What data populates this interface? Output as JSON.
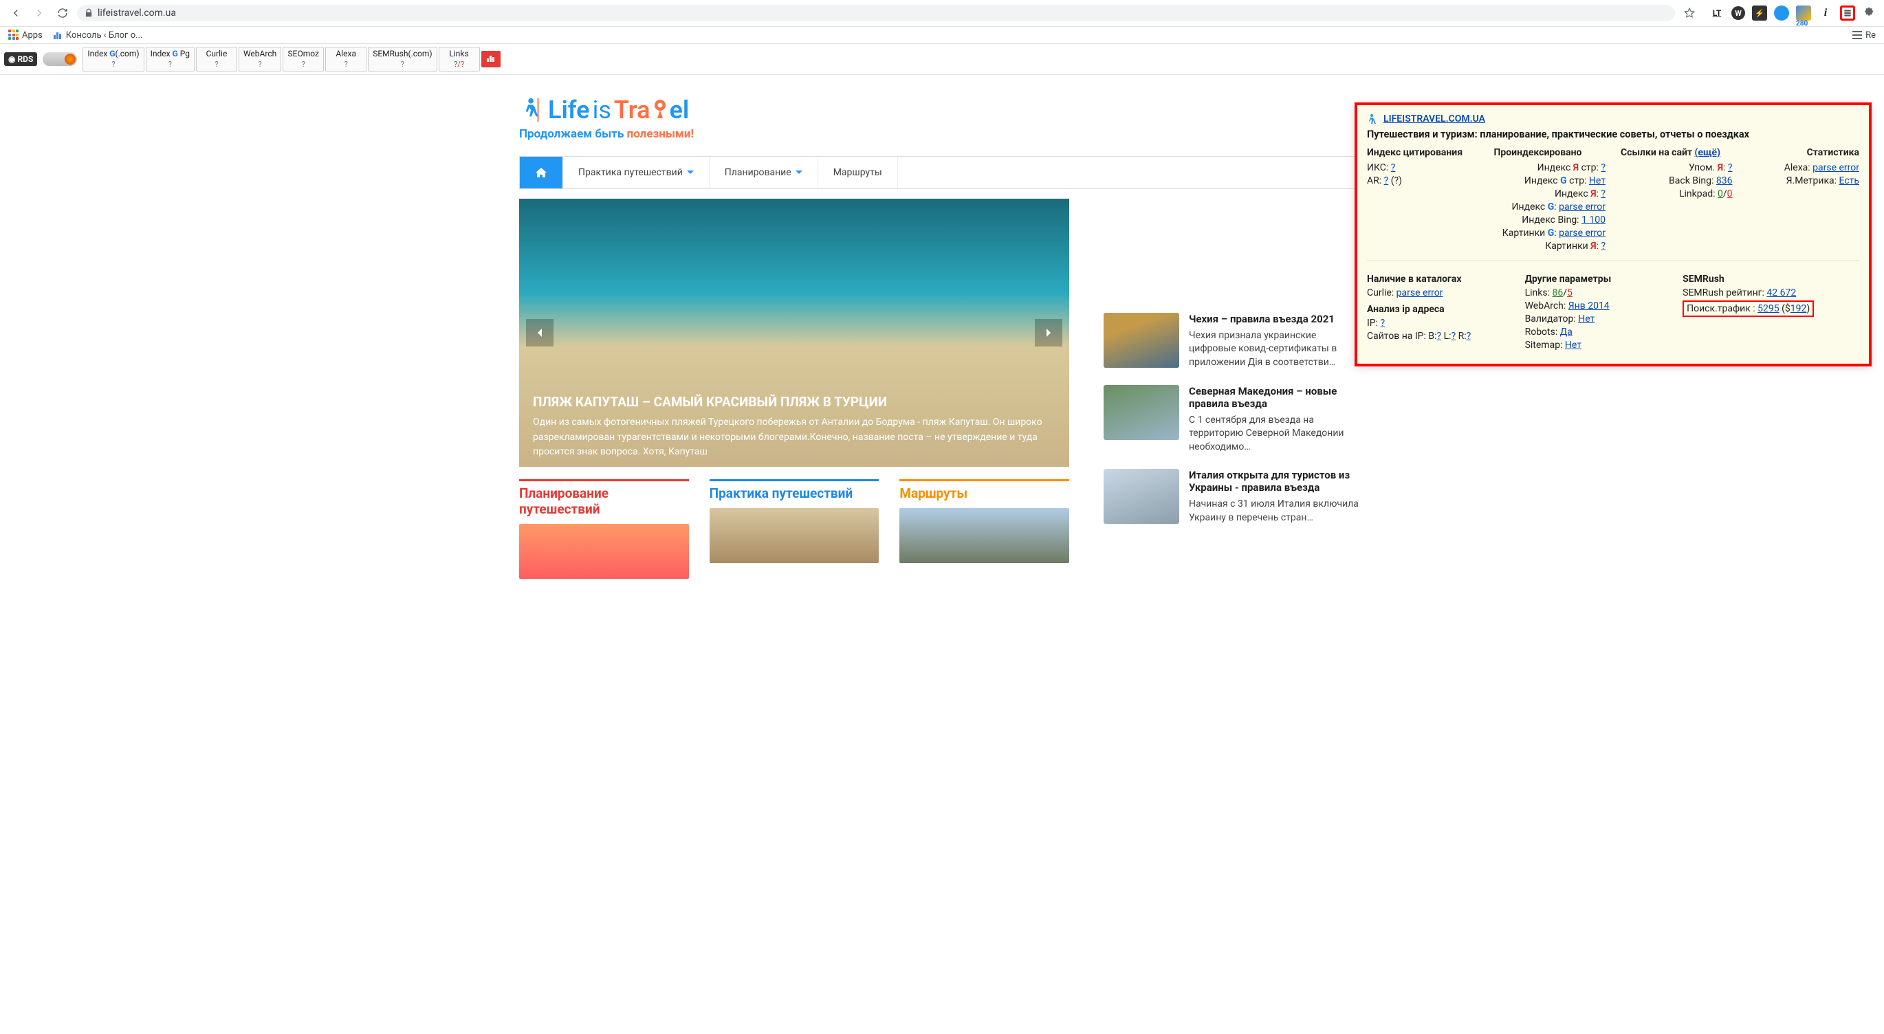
{
  "browser": {
    "url_host": "lifeistravel.com.ua",
    "bookmarks": {
      "apps_label": "Apps",
      "konsol_label": "Консоль ‹ Блог о...",
      "right_label": "Re"
    },
    "ext_badge": "280",
    "ext_info": "i"
  },
  "toolbar": {
    "rds": "RDS",
    "items": [
      {
        "t": "Index G(.com)",
        "s": "?"
      },
      {
        "t": "Index G Pg",
        "s": "?"
      },
      {
        "t": "Curlie",
        "s": "?"
      },
      {
        "t": "WebArch",
        "s": "?"
      },
      {
        "t": "SEOmoz",
        "s": "?"
      },
      {
        "t": "Alexa",
        "s": "?"
      },
      {
        "t": "SEMRush(.com)",
        "s": "?"
      },
      {
        "t": "Links",
        "s": "?/?"
      }
    ]
  },
  "logo": {
    "life": "Life",
    "is": "is",
    "tra": "Tra",
    "el": "el"
  },
  "tagline": {
    "a": "Продолжаем быть ",
    "b": "полезными!"
  },
  "nav": {
    "practice": "Практика путешествий",
    "planning": "Планирование",
    "routes": "Маршруты"
  },
  "hero": {
    "title": "ПЛЯЖ КАПУТАШ – САМЫЙ КРАСИВЫЙ ПЛЯЖ В ТУРЦИИ",
    "text": "Один из самых фотогеничных пляжей Турецкого побережья от Анталии до Бодрума - пляж Капуташ. Он широко разрекламирован турагентствами и некоторыми блогерами.Конечно, название поста – не утверждение и туда просится знак вопроса. Хотя, Капуташ"
  },
  "columns": {
    "c1": "Планирование путешествий",
    "c2": "Практика путешествий",
    "c3": "Маршруты"
  },
  "sidebar_items": [
    {
      "title": "Чехия – правила въезда 2021",
      "text": "Чехия признала украинские цифровые ковид-сертификаты в приложении Дія в соответстви…"
    },
    {
      "title": "Северная Македония – новые правила въезда",
      "text": "С 1 сентября для въезда на территорию Северной Македонии необходимо…"
    },
    {
      "title": "Италия открыта для туристов из Украины - правила въезда",
      "text": "Начиная с 31 июля Италия включила Украину в перечень стран…"
    }
  ],
  "overlay": {
    "site": "LIFEISTRAVEL.COM.UA",
    "title": "Путешествия и туризм: планирование, практические советы, отчеты о поездках",
    "sec1": {
      "h": "Индекс цитирования",
      "iks": "ИКС: ",
      "iks_v": "?",
      "ar": "AR: ",
      "ar_v": "?",
      "ar_p": " (?)"
    },
    "sec2": {
      "h": "Проиндексировано",
      "r": [
        {
          "l": "Индекс Я стр: ",
          "cls": "",
          "v": "?"
        },
        {
          "l": "Индекс G стр: ",
          "cls": "",
          "v": "Нет"
        },
        {
          "l": "Индекс Я: ",
          "cls": "",
          "v": "?"
        },
        {
          "l": "Индекс G: ",
          "cls": "",
          "v": "parse error"
        },
        {
          "l": "Индекс Bing: ",
          "cls": "",
          "v": "1 100"
        },
        {
          "l": "Картинки G: ",
          "cls": "",
          "v": "parse error"
        },
        {
          "l": "Картинки Я: ",
          "cls": "",
          "v": "?"
        }
      ]
    },
    "sec3": {
      "h": "Ссылки на сайт ",
      "more": "(ещё)",
      "r": [
        {
          "l": "Упом. Я: ",
          "v": "?"
        },
        {
          "l": "Back Bing: ",
          "v": "836"
        },
        {
          "l": "Linkpad: ",
          "v1": "0",
          "sep": "/",
          "v2": "0"
        }
      ]
    },
    "sec4": {
      "h": "Статистика",
      "r": [
        {
          "l": "Alexa: ",
          "v": "parse error"
        },
        {
          "l": "Я.Метрика: ",
          "v": "Есть"
        }
      ]
    },
    "cat": {
      "h": "Наличие в каталогах",
      "curlie_l": "Curlie: ",
      "curlie_v": "parse error"
    },
    "ip": {
      "h": "Анализ ip адреса",
      "ip_l": "IP: ",
      "ip_v": "?",
      "sites_l": "Сайтов на IP:  B:",
      "b": "?",
      "l": " L:",
      "lv": "?",
      "r": " R:",
      "rv": "?"
    },
    "other": {
      "h": "Другие параметры",
      "links_l": "Links: ",
      "links_a": "86",
      "links_sep": "/",
      "links_b": "5",
      "wa_l": "WebArch: ",
      "wa_v": "Янв 2014",
      "val_l": "Валидатор: ",
      "val_v": "Нет",
      "rob_l": "Robots: ",
      "rob_v": "Да",
      "sm_l": "Sitemap: ",
      "sm_v": "Нет"
    },
    "sem": {
      "h": "SEMRush",
      "rank_l": "SEMRush рейтинг: ",
      "rank_v": "42 672",
      "traf_l": "Поиск.трафик : ",
      "traf_v": "5295",
      "traf_d": " ($",
      "traf_dv": "192",
      "traf_close": ")"
    }
  }
}
